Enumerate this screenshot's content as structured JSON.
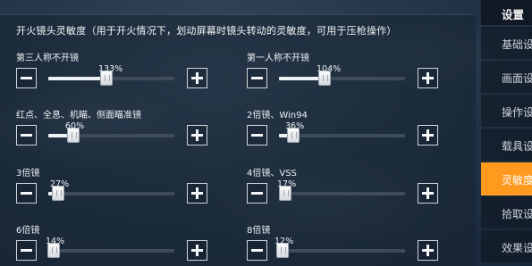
{
  "section_title": "开火镜头灵敏度（用于开火情况下，划动屏幕时镜头转动的灵敏度，可用于压枪操作）",
  "settings": [
    {
      "label": "第三人称不开镜",
      "value_text": "133%",
      "value": 0.46
    },
    {
      "label": "第一人称不开镜",
      "value_text": "104%",
      "value": 0.36
    },
    {
      "label": "红点、全息、机瞄、侧面瞄准镜",
      "value_text": "60%",
      "value": 0.2
    },
    {
      "label": "2倍镜、Win94",
      "value_text": "36%",
      "value": 0.11
    },
    {
      "label": "3倍镜",
      "value_text": "27%",
      "value": 0.08
    },
    {
      "label": "4倍镜、VSS",
      "value_text": "17%",
      "value": 0.05
    },
    {
      "label": "6倍镜",
      "value_text": "14%",
      "value": 0.04
    },
    {
      "label": "8倍镜",
      "value_text": "12%",
      "value": 0.03
    }
  ],
  "sidebar": {
    "title": "设置",
    "items": [
      {
        "label": "基础设置",
        "active": false
      },
      {
        "label": "画面设置",
        "active": false
      },
      {
        "label": "操作设置",
        "active": false
      },
      {
        "label": "载具设置",
        "active": false
      },
      {
        "label": "灵敏度设置",
        "active": true
      },
      {
        "label": "拾取设置",
        "active": false
      },
      {
        "label": "效果设置",
        "active": false
      }
    ]
  },
  "colors": {
    "accent": "#ff9a1e",
    "track": "#3e4b58",
    "fill": "#eef1f4"
  }
}
